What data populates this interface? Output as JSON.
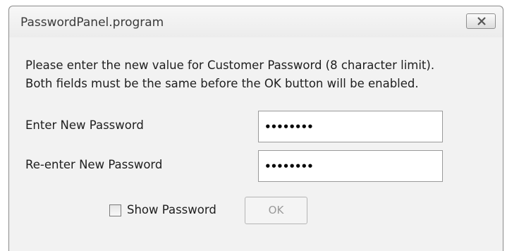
{
  "window": {
    "title": "PasswordPanel.program",
    "close_icon": "close-icon"
  },
  "instructions": {
    "line1": "Please enter the new value for Customer Password (8 character limit).",
    "line2": "Both fields must be the same before the OK button will be enabled."
  },
  "fields": {
    "new_password": {
      "label": "Enter New Password",
      "value": "••••••••"
    },
    "reenter_password": {
      "label": "Re-enter New Password",
      "value": "••••••••"
    }
  },
  "show_password": {
    "label": "Show Password",
    "checked": false
  },
  "ok_button": {
    "label": "OK",
    "enabled": false
  }
}
